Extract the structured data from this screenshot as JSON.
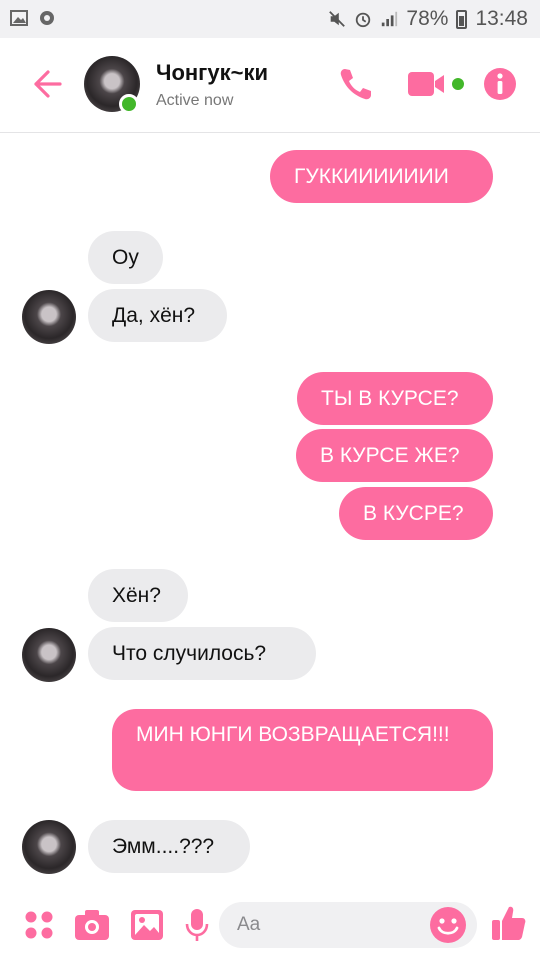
{
  "status_bar": {
    "battery": "78%",
    "time": "13:48"
  },
  "header": {
    "contact_name": "Чонгук~ки",
    "contact_status": "Active now"
  },
  "messages": [
    {
      "side": "out",
      "text": "ГУККИИИИИИИ"
    },
    {
      "side": "in",
      "text": "Оу"
    },
    {
      "side": "in",
      "text": "Да, хён?"
    },
    {
      "side": "out",
      "text": "ТЫ В КУРСЕ?"
    },
    {
      "side": "out",
      "text": "В КУРСЕ ЖЕ?"
    },
    {
      "side": "out",
      "text": "В КУСРЕ?"
    },
    {
      "side": "in",
      "text": "Хён?"
    },
    {
      "side": "in",
      "text": "Что случилось?"
    },
    {
      "side": "out",
      "text": "МИН ЮНГИ ВОЗВРАЩАЕТСЯ!!!"
    },
    {
      "side": "in",
      "text": "Эмм....???"
    }
  ],
  "composer": {
    "placeholder": "Aa"
  },
  "colors": {
    "accent": "#fd6ca0",
    "incoming_bubble": "#ebebed",
    "online": "#42b72a"
  },
  "icons": [
    "back-arrow-icon",
    "phone-icon",
    "video-camera-icon",
    "info-icon",
    "apps-icon",
    "camera-icon",
    "gallery-icon",
    "microphone-icon",
    "emoji-icon",
    "thumbs-up-icon"
  ]
}
